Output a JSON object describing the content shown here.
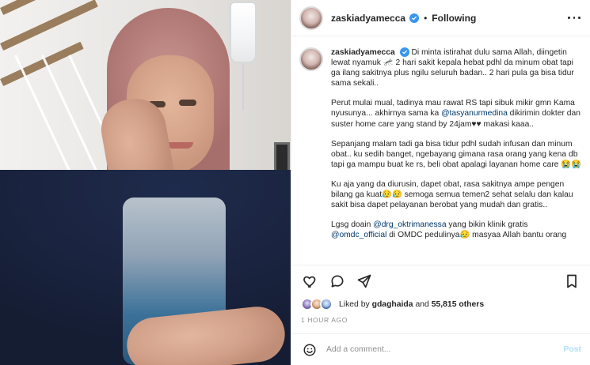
{
  "post": {
    "username": "zaskiadyamecca",
    "follow_status": "Following",
    "caption": {
      "username": "zaskiadyamecca",
      "paragraphs": [
        {
          "text": "Di minta istirahat dulu sama Allah, diingetin lewat nyamuk 🦟 2 hari sakit kepala hebat pdhl da minum obat tapi ga ilang sakitnya plus ngilu seluruh badan.. 2 hari pula ga bisa tidur sama sekali.."
        },
        {
          "text_before": "Perut mulai mual, tadinya mau rawat RS tapi sibuk mikir gmn Kama nyusunya... akhirnya sama ka ",
          "mention": "@tasyanurmedina",
          "text_after": " dikirimin dokter dan suster home care yang stand by 24jam♥♥ makasi kaaa.."
        },
        {
          "text": "Sepanjang malam tadi ga bisa tidur pdhl sudah infusan dan minum obat.. ku sedih banget, ngebayang gimana rasa orang yang kena db tapi ga mampu buat ke rs, beli obat apalagi layanan home care 😭😭"
        },
        {
          "text": "Ku aja yang da diurusin, dapet obat, rasa sakitnya ampe pengen bilang ga kuat😥😥 semoga semua temen2 sehat selalu dan kalau sakit bisa dapet pelayanan berobat yang mudah dan gratis.."
        },
        {
          "text_before": "Lgsg doain ",
          "mention": "@drg_oktrimanessa",
          "text_after": " yang bikin klinik gratis ",
          "mention2": "@omdc_official",
          "text_after2": " di OMDC pedulinya😥 masyaa Allah bantu orang"
        }
      ]
    },
    "likes": {
      "label_prefix": "Liked by",
      "first_user": "gdaghaida",
      "label_mid": "and",
      "count": "55,815 others"
    },
    "timestamp": "1 HOUR AGO",
    "comment": {
      "placeholder": "Add a comment...",
      "post_label": "Post"
    }
  },
  "icons": {
    "verified": "verified-badge-icon",
    "more": "more-options-icon",
    "like": "heart-icon",
    "comment": "comment-icon",
    "share": "send-icon",
    "save": "bookmark-icon",
    "emoji": "emoji-icon"
  },
  "colors": {
    "link": "#00376b",
    "verified": "#3897f0",
    "muted": "#8e8e8e",
    "post_disabled": "#b2dffc"
  }
}
